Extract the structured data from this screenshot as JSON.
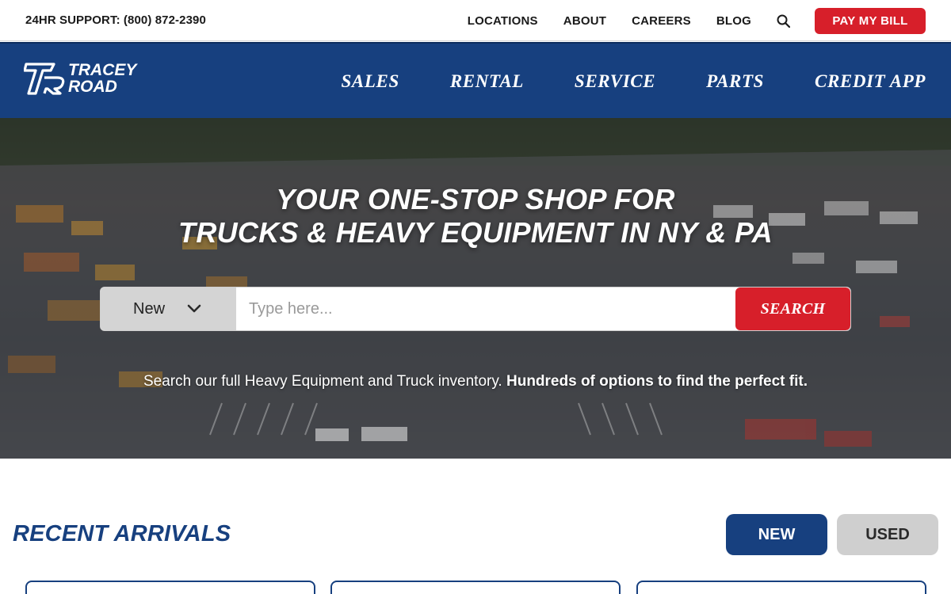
{
  "topbar": {
    "support": "24HR SUPPORT: (800) 872-2390",
    "links": [
      "LOCATIONS",
      "ABOUT",
      "CAREERS",
      "BLOG"
    ],
    "search_icon": "search-icon",
    "pay_bill": "PAY MY BILL"
  },
  "brand": {
    "logo_mark": "TR",
    "line1": "TRACEY",
    "line2": "ROAD"
  },
  "nav": {
    "items": [
      "SALES",
      "RENTAL",
      "SERVICE",
      "PARTS",
      "CREDIT APP"
    ]
  },
  "hero": {
    "title_line1": "YOUR ONE-STOP SHOP FOR",
    "title_line2": "TRUCKS & HEAVY EQUIPMENT IN NY & PA",
    "condition_selected": "New",
    "search_placeholder": "Type here...",
    "search_button": "SEARCH",
    "subtext_regular": "Search our full Heavy Equipment and Truck inventory.",
    "subtext_bold": "Hundreds of options to find the perfect fit."
  },
  "arrivals": {
    "title": "RECENT ARRIVALS",
    "toggle_new": "NEW",
    "toggle_used": "USED"
  },
  "colors": {
    "brand_blue": "#17407f",
    "accent_red": "#d71f2a",
    "toggle_inactive": "#cfcfcf"
  }
}
